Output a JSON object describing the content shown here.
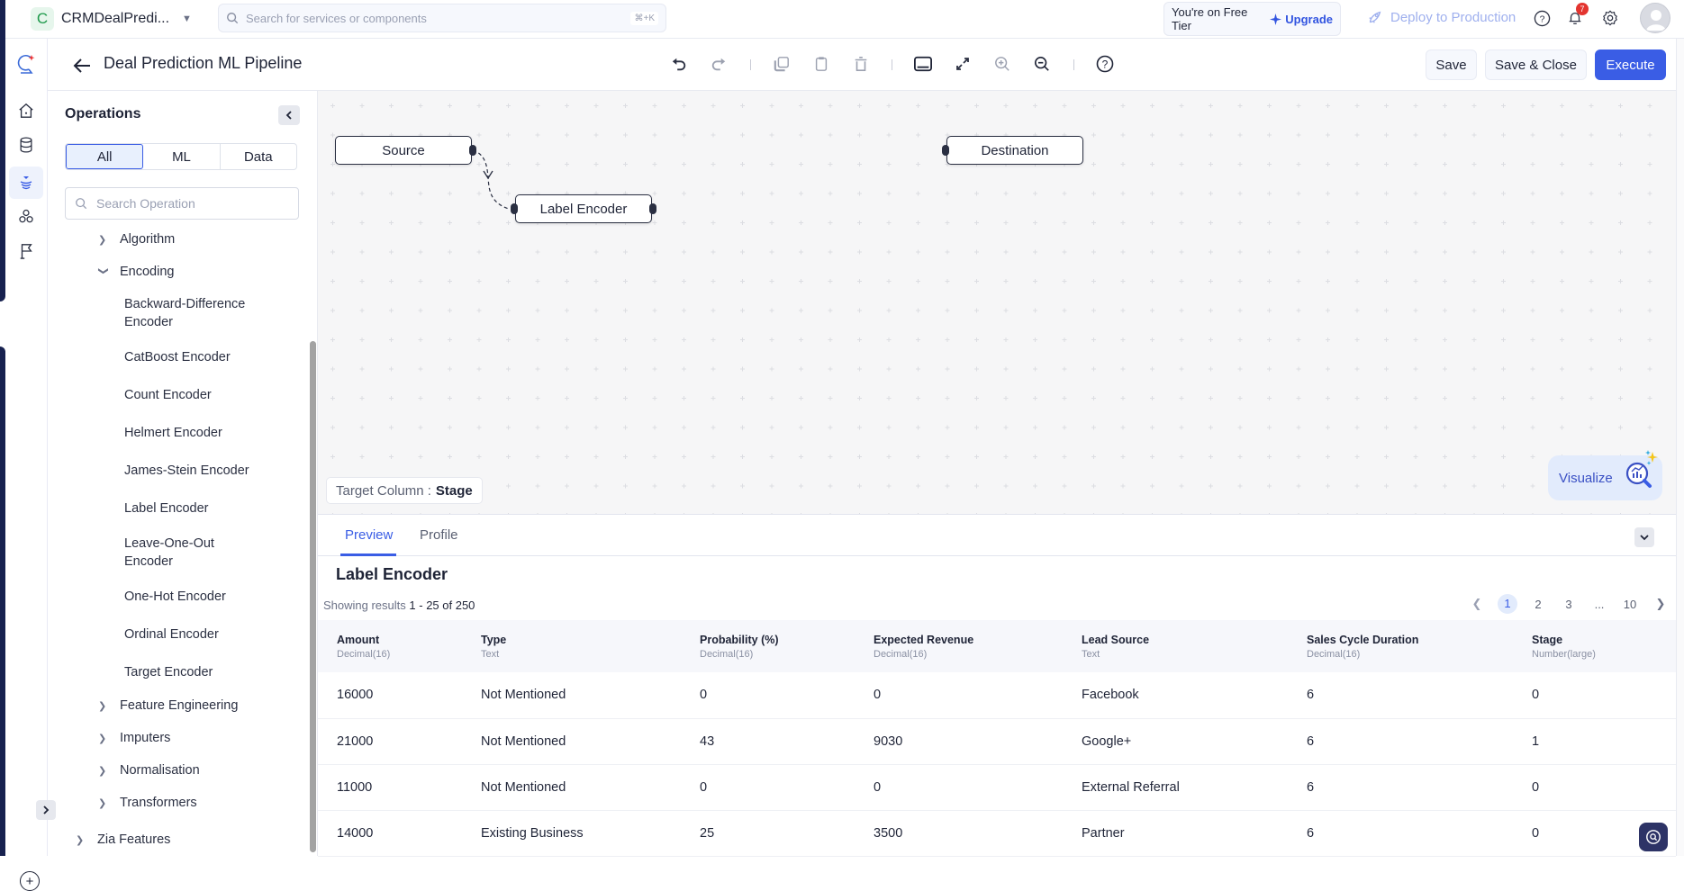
{
  "topbar": {
    "project_initial": "C",
    "project_name": "CRMDealPredi...",
    "search_placeholder": "Search for services or components",
    "search_shortcut": "⌘+K",
    "tier_text": "You're on Free Tier",
    "upgrade_label": "Upgrade",
    "deploy_label": "Deploy to Production",
    "notification_count": "7"
  },
  "header": {
    "title": "Deal Prediction ML Pipeline",
    "save_label": "Save",
    "save_close_label": "Save & Close",
    "execute_label": "Execute"
  },
  "operations": {
    "title": "Operations",
    "filters": [
      "All",
      "ML",
      "Data"
    ],
    "active_filter": "All",
    "search_placeholder": "Search Operation",
    "tree": {
      "algorithm": "Algorithm",
      "encoding": "Encoding",
      "encoders": [
        "Backward-Difference Encoder",
        "CatBoost Encoder",
        "Count Encoder",
        "Helmert Encoder",
        "James-Stein Encoder",
        "Label Encoder",
        "Leave-One-Out Encoder",
        "One-Hot Encoder",
        "Ordinal Encoder",
        "Target Encoder"
      ],
      "feature_engineering": "Feature Engineering",
      "imputers": "Imputers",
      "normalisation": "Normalisation",
      "transformers": "Transformers",
      "zia_features": "Zia Features"
    }
  },
  "canvas": {
    "nodes": {
      "source": "Source",
      "label_encoder": "Label Encoder",
      "destination": "Destination"
    },
    "target_label": "Target Column :",
    "target_value": "Stage",
    "visualize_label": "Visualize"
  },
  "preview": {
    "tabs": [
      "Preview",
      "Profile"
    ],
    "active_tab": "Preview",
    "section_title": "Label Encoder",
    "showing_prefix": "Showing results",
    "showing_range": "1 - 25 of 250",
    "pages": [
      "1",
      "2",
      "3",
      "...",
      "10"
    ],
    "current_page": "1",
    "columns": [
      {
        "name": "Amount",
        "type": "Decimal(16)"
      },
      {
        "name": "Type",
        "type": "Text"
      },
      {
        "name": "Probability (%)",
        "type": "Decimal(16)"
      },
      {
        "name": "Expected Revenue",
        "type": "Decimal(16)"
      },
      {
        "name": "Lead Source",
        "type": "Text"
      },
      {
        "name": "Sales Cycle Duration",
        "type": "Decimal(16)"
      },
      {
        "name": "Stage",
        "type": "Number(large)"
      }
    ],
    "rows": [
      [
        "16000",
        "Not Mentioned",
        "0",
        "0",
        "Facebook",
        "6",
        "0"
      ],
      [
        "21000",
        "Not Mentioned",
        "43",
        "9030",
        "Google+",
        "6",
        "1"
      ],
      [
        "11000",
        "Not Mentioned",
        "0",
        "0",
        "External Referral",
        "6",
        "0"
      ],
      [
        "14000",
        "Existing Business",
        "25",
        "3500",
        "Partner",
        "6",
        "0"
      ]
    ]
  },
  "colors": {
    "accent": "#3a5de5",
    "rail_edge": "#17214f",
    "canvas_bg": "#f6f6f7",
    "notification": "#e3342f"
  }
}
